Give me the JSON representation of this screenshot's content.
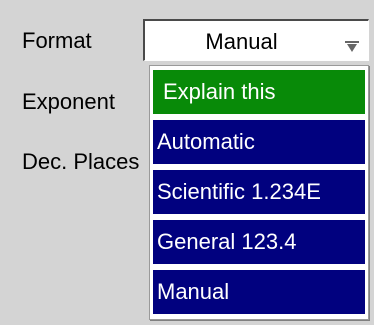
{
  "form": {
    "labels": {
      "format": "Format",
      "exponent": "Exponent",
      "decimal_places": "Dec. Places"
    },
    "format_select": {
      "value": "Manual",
      "arrow_icon": "dropdown-arrow-icon"
    }
  },
  "dropdown": {
    "options": [
      {
        "label": "Explain this",
        "kind": "help"
      },
      {
        "label": "Automatic",
        "kind": "option"
      },
      {
        "label": "Scientific 1.234E",
        "kind": "option"
      },
      {
        "label": "General 123.4",
        "kind": "option"
      },
      {
        "label": "Manual",
        "kind": "option"
      }
    ]
  },
  "colors": {
    "background": "#d4d4d4",
    "option_background": "#01017f",
    "help_background": "#088a08",
    "option_text": "#ffffff"
  }
}
